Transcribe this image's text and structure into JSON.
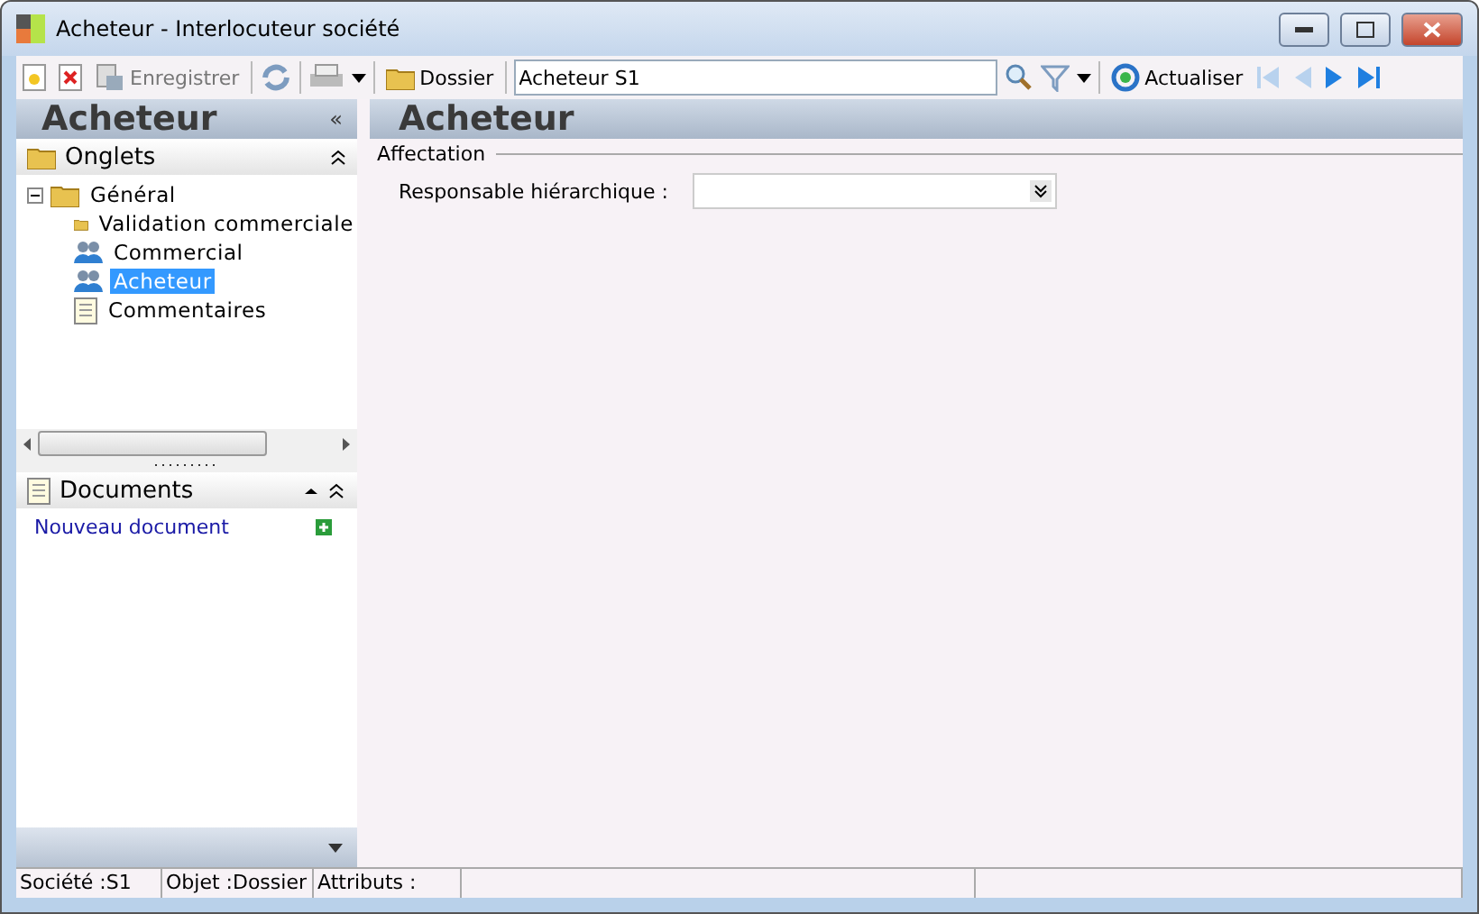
{
  "window": {
    "title": "Acheteur -  Interlocuteur société"
  },
  "toolbar": {
    "save": "Enregistrer",
    "folder": "Dossier",
    "search_value": "Acheteur S1",
    "refresh": "Actualiser"
  },
  "left_panel": {
    "title": "Acheteur",
    "collapse": "«"
  },
  "tabs_section": {
    "title": "Onglets",
    "tree": [
      {
        "label": "Général",
        "kind": "folder",
        "expanded": true,
        "selected": false,
        "children": [
          {
            "label": "Validation commerciale",
            "kind": "folder",
            "selected": false
          },
          {
            "label": "Commercial",
            "kind": "users",
            "selected": false
          },
          {
            "label": "Acheteur",
            "kind": "users",
            "selected": true
          },
          {
            "label": "Commentaires",
            "kind": "note",
            "selected": false
          }
        ]
      }
    ]
  },
  "documents_section": {
    "title": "Documents",
    "link": "Nouveau document"
  },
  "main": {
    "title": "Acheteur",
    "group": "Affectation",
    "fields": [
      {
        "label": "Responsable hiérarchique :"
      }
    ]
  },
  "status_bar": [
    "Société :S1",
    "Objet :Dossier",
    "Attributs :"
  ]
}
